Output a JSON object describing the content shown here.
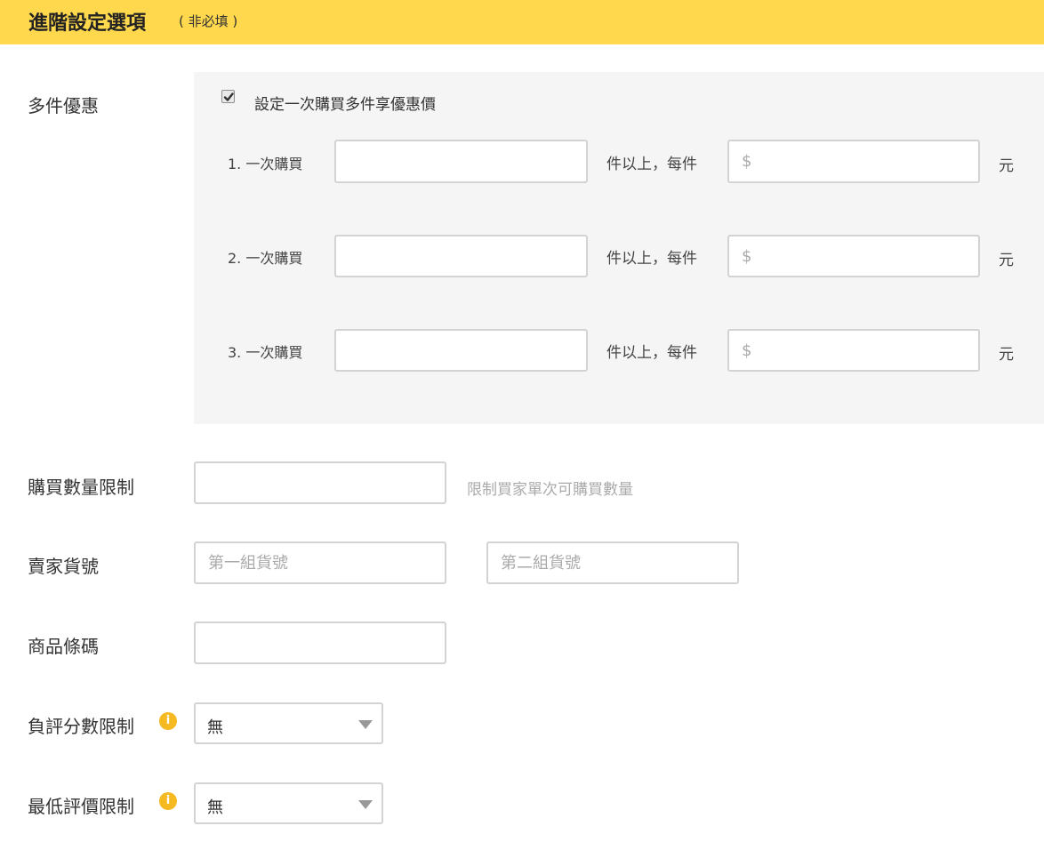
{
  "header": {
    "title": "進階設定選項",
    "note": "( 非必填 )"
  },
  "multi_discount": {
    "label": "多件優惠",
    "checkbox_label": "設定一次購買多件享優惠價",
    "checked": true,
    "tiers": [
      {
        "prefix": "1. 一次購買",
        "quantity": "",
        "mid": "件以上，每件",
        "price_placeholder": "$",
        "unit": "元"
      },
      {
        "prefix": "2. 一次購買",
        "quantity": "",
        "mid": "件以上，每件",
        "price_placeholder": "$",
        "unit": "元"
      },
      {
        "prefix": "3. 一次購買",
        "quantity": "",
        "mid": "件以上，每件",
        "price_placeholder": "$",
        "unit": "元"
      }
    ]
  },
  "purchase_limit": {
    "label": "購買數量限制",
    "value": "",
    "hint": "限制買家單次可購買數量"
  },
  "seller_sku": {
    "label": "賣家貨號",
    "first_placeholder": "第一組貨號",
    "second_placeholder": "第二組貨號"
  },
  "barcode": {
    "label": "商品條碼",
    "value": ""
  },
  "negative_rating_limit": {
    "label": "負評分數限制",
    "icon": "info-icon",
    "selected": "無"
  },
  "min_rating_limit": {
    "label": "最低評價限制",
    "icon": "info-icon",
    "selected": "無"
  },
  "colors": {
    "header_bg": "#ffd84d",
    "panel_bg": "#f5f5f5",
    "info_icon": "#f5b921"
  }
}
